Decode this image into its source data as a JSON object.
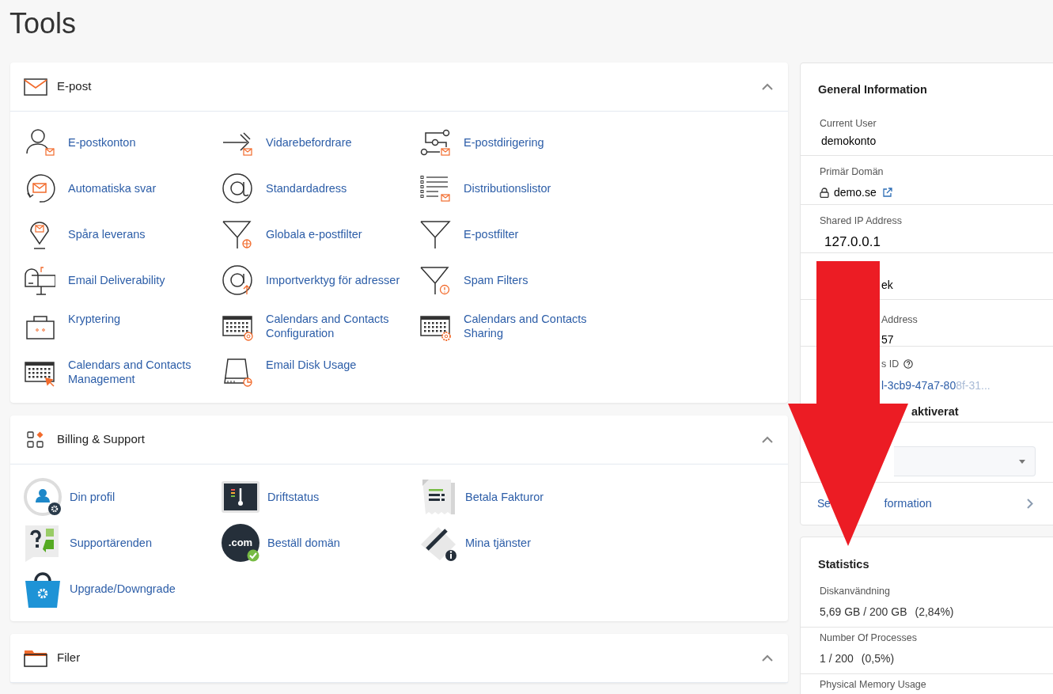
{
  "page_title": "Tools",
  "sections": [
    {
      "title": "E-post",
      "expanded": true,
      "items": [
        {
          "label": "E-postkonton"
        },
        {
          "label": "Vidarebefordrare"
        },
        {
          "label": "E-postdirigering"
        },
        {
          "label": "Automatiska svar"
        },
        {
          "label": "Standardadress"
        },
        {
          "label": "Distributionslistor"
        },
        {
          "label": "Spåra leverans"
        },
        {
          "label": "Globala e-postfilter"
        },
        {
          "label": "E-postfilter"
        },
        {
          "label": "Email Deliverability"
        },
        {
          "label": "Importverktyg för adresser"
        },
        {
          "label": "Spam Filters"
        },
        {
          "label": "Kryptering"
        },
        {
          "label": "Calendars and Contacts Configuration"
        },
        {
          "label": "Calendars and Contacts Sharing"
        },
        {
          "label": "Calendars and Contacts Management"
        },
        {
          "label": "Email Disk Usage"
        }
      ]
    },
    {
      "title": "Billing & Support",
      "expanded": true,
      "items": [
        {
          "label": "Din profil"
        },
        {
          "label": "Driftstatus"
        },
        {
          "label": "Betala Fakturor"
        },
        {
          "label": "Supportärenden"
        },
        {
          "label": "Beställ domän",
          "badge": ".com"
        },
        {
          "label": "Mina tjänster"
        },
        {
          "label": "Upgrade/Downgrade"
        }
      ]
    },
    {
      "title": "Filer",
      "expanded": true
    }
  ],
  "general_information": {
    "title": "General Information",
    "rows": [
      {
        "kind": "text",
        "label": "Current User",
        "value": "demokonto"
      },
      {
        "kind": "domain",
        "label": "Primär Domän",
        "value": "demo.se"
      },
      {
        "kind": "ip",
        "label": "Shared IP Address",
        "value": "127.0.0.1"
      },
      {
        "kind": "covered",
        "value": "ek"
      },
      {
        "kind": "covered",
        "label": "Address",
        "value": "57"
      },
      {
        "kind": "covered-id",
        "label": "s ID",
        "value": "l-3cb9-47a7-80",
        "value_faded": "8f-31...",
        "note": "aktiverat"
      },
      {
        "kind": "select"
      },
      {
        "kind": "link",
        "label_start": "Se",
        "label_end": "formation"
      }
    ]
  },
  "statistics": {
    "title": "Statistics",
    "rows": [
      {
        "label": "Diskanvändning",
        "value": "5,69 GB / 200 GB",
        "percent": "(2,84%)"
      },
      {
        "label": "Number Of Processes",
        "value": "1 / 200",
        "percent": "(0,5%)"
      },
      {
        "label": "Physical Memory Usage"
      }
    ]
  }
}
